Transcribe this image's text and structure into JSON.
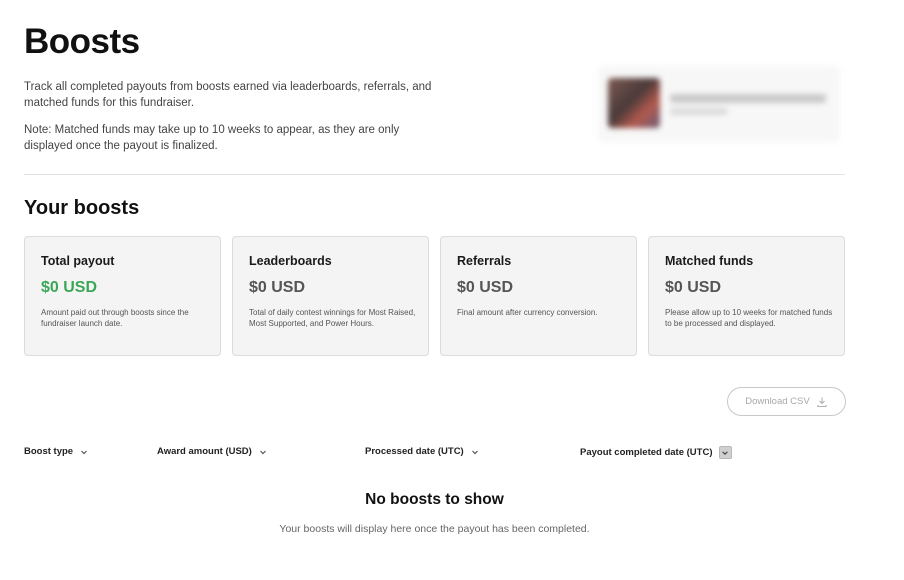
{
  "header": {
    "title": "Boosts",
    "intro": "Track all completed payouts from boosts earned via leaderboards, referrals, and matched funds for this fundraiser.",
    "note": "Note: Matched funds may take up to 10 weeks to appear, as they are only displayed once the payout is finalized."
  },
  "section_title": "Your boosts",
  "cards": [
    {
      "title": "Total payout",
      "value": "$0 USD",
      "desc": "Amount paid out through boosts since the fundraiser launch date.",
      "value_color": "#3aa757"
    },
    {
      "title": "Leaderboards",
      "value": "$0 USD",
      "desc": "Total of daily contest winnings for Most Raised, Most Supported, and Power Hours."
    },
    {
      "title": "Referrals",
      "value": "$0 USD",
      "desc": "Final amount after currency conversion."
    },
    {
      "title": "Matched funds",
      "value": "$0 USD",
      "desc": "Please allow up to 10 weeks for matched funds to be processed and displayed."
    }
  ],
  "download": {
    "label": "Download CSV",
    "icon": "download-icon"
  },
  "table": {
    "columns": [
      {
        "label": "Boost type",
        "icon": "chevron-down-icon"
      },
      {
        "label": "Award amount (USD)",
        "icon": "chevron-down-icon"
      },
      {
        "label": "Processed date (UTC)",
        "icon": "chevron-down-icon"
      },
      {
        "label": "Payout completed date (UTC)",
        "icon": "chevron-down-icon",
        "active": true
      }
    ]
  },
  "empty_state": {
    "title": "No boosts to show",
    "desc": "Your boosts will display here once the payout has been completed."
  }
}
